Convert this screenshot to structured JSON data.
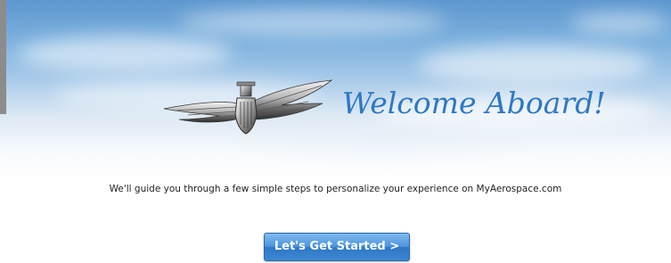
{
  "welcome": {
    "heading": "Welcome Aboard!",
    "emblem_icon": "pilot-wings-icon"
  },
  "intro": {
    "message": "We'll guide you through a few simple steps to personalize your experience on MyAerospace.com"
  },
  "actions": {
    "start_label": "Let's Get Started >"
  },
  "colors": {
    "heading": "#2f78c2",
    "button": "#3d86d2",
    "sky": "#5d97cf"
  }
}
